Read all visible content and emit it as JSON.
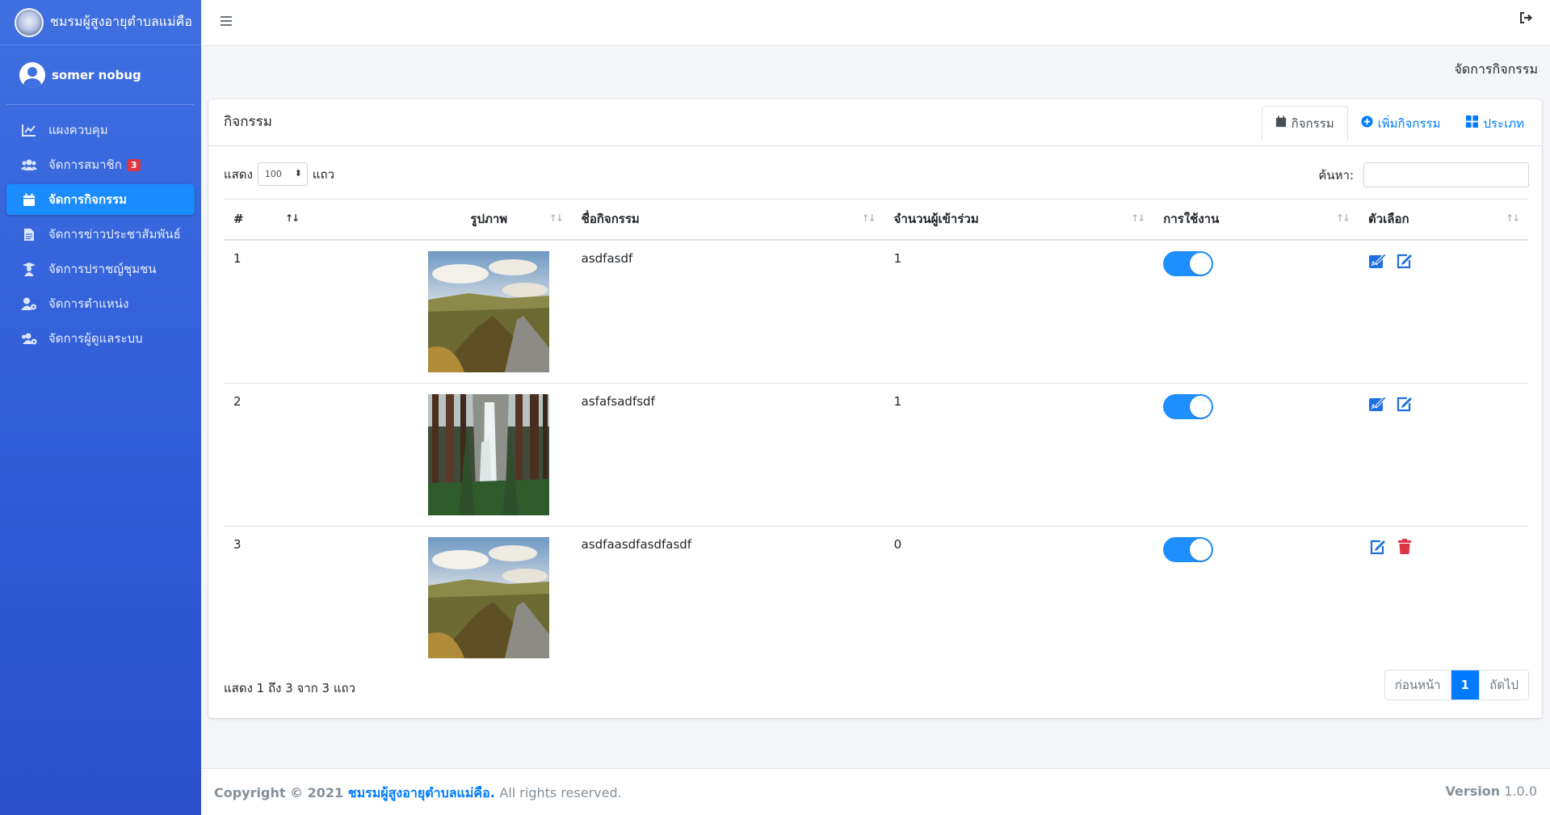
{
  "brand": {
    "name": "ชมรมผู้สูงอายุตำบลแม่คือ"
  },
  "user": {
    "name": "somer nobug"
  },
  "sidebar": {
    "items": [
      {
        "label": "แผงควบคุม",
        "icon": "chart-line-icon"
      },
      {
        "label": "จัดการสมาชิก",
        "icon": "users-icon",
        "badge": "3"
      },
      {
        "label": "จัดการกิจกรรม",
        "icon": "calendar-icon",
        "active": true
      },
      {
        "label": "จัดการข่าวประชาสัมพันธ์",
        "icon": "file-icon"
      },
      {
        "label": "จัดการปราชญ์ชุมชน",
        "icon": "teacher-icon"
      },
      {
        "label": "จัดการตำแหน่ง",
        "icon": "user-cog-icon"
      },
      {
        "label": "จัดการผู้ดูแลระบบ",
        "icon": "users-cog-icon"
      }
    ]
  },
  "page": {
    "header": "จัดการกิจกรรม"
  },
  "card": {
    "title": "กิจกรรม",
    "tabs": [
      {
        "label": "กิจกรรม",
        "icon": "calendar-icon"
      },
      {
        "label": "เพิ่มกิจกรรม",
        "icon": "plus-circle-icon"
      },
      {
        "label": "ประเภท",
        "icon": "grid-icon"
      }
    ]
  },
  "controls": {
    "show_label": "แสดง",
    "length_value": "100",
    "rows_label": "แถว",
    "search_label": "ค้นหา:",
    "search_value": ""
  },
  "table": {
    "headers": [
      "#",
      "รูปภาพ",
      "ชื่อกิจกรรม",
      "จำนวนผู้เข้าร่วม",
      "การใช้งาน",
      "ตัวเลือก"
    ],
    "rows": [
      {
        "num": "1",
        "image": "landscape-road-photo",
        "name": "asdfasdf",
        "participants": "1",
        "enabled": true,
        "actions": [
          "edit-sign-icon",
          "edit-icon"
        ]
      },
      {
        "num": "2",
        "image": "waterfall-forest-photo",
        "name": "asfafsadfsdf",
        "participants": "1",
        "enabled": true,
        "actions": [
          "edit-sign-icon",
          "edit-icon"
        ]
      },
      {
        "num": "3",
        "image": "landscape-road-photo",
        "name": "asdfaasdfasdfasdf",
        "participants": "0",
        "enabled": true,
        "actions": [
          "edit-icon",
          "trash-icon"
        ]
      }
    ]
  },
  "info": "แสดง 1 ถึง 3 จาก 3 แถว",
  "pagination": {
    "prev": "ก่อนหน้า",
    "current": "1",
    "next": "ถัดไป"
  },
  "footer": {
    "copyright": "Copyright © 2021",
    "org": "ชมรมผู้สูงอายุตำบลแม่คือ.",
    "rights": "All rights reserved.",
    "version_label": "Version",
    "version": "1.0.0"
  },
  "colors": {
    "sidebar": "#3f6fe0",
    "active": "#1a8cff",
    "link": "#007bff",
    "danger": "#dc3545"
  }
}
